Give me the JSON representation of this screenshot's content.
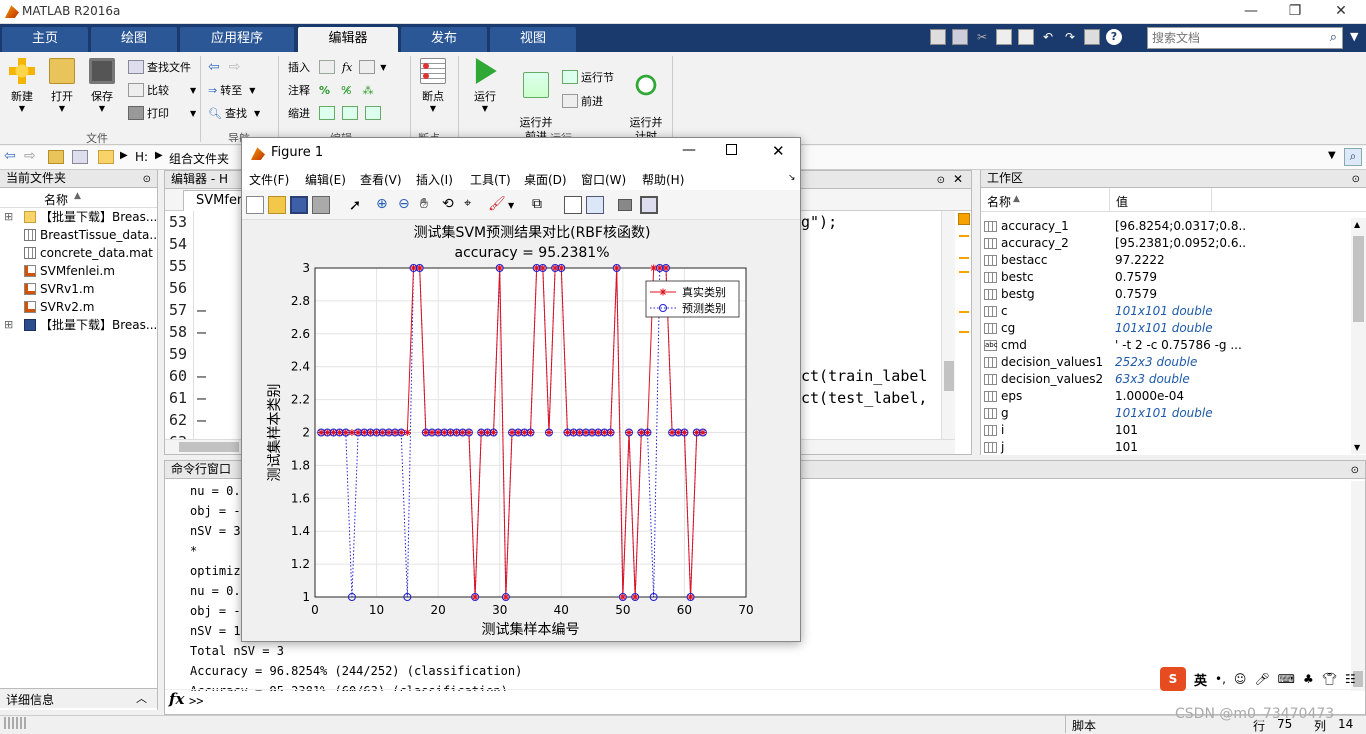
{
  "window": {
    "title": "MATLAB R2016a"
  },
  "tabs": [
    {
      "label": "主页"
    },
    {
      "label": "绘图"
    },
    {
      "label": "应用程序"
    },
    {
      "label": "编辑器"
    },
    {
      "label": "发布"
    },
    {
      "label": "视图"
    }
  ],
  "search": {
    "placeholder": "搜索文档"
  },
  "ribbon": {
    "new": "新建",
    "open": "打开",
    "save": "保存",
    "find_files": "查找文件",
    "compare": "比较",
    "print": "打印",
    "file_group": "文件",
    "goto_back": "转至",
    "find": "查找",
    "nav_group": "导航",
    "insert": "插入",
    "comment": "注释",
    "indent": "缩进",
    "edit_group": "编辑",
    "breakpoints": "断点",
    "bp_group": "断点",
    "run": "运行",
    "run_advance": "运行并\n前进",
    "run_section": "运行节",
    "advance": "前进",
    "run_time": "运行并\n计时",
    "run_group": "运行"
  },
  "address": {
    "drive": "H:",
    "folder": "组合文件夹"
  },
  "current_folder": {
    "title": "当前文件夹",
    "col_name": "名称",
    "items": [
      {
        "name": "【批量下载】Breas...",
        "icon": "folder-icon"
      },
      {
        "name": "BreastTissue_data...",
        "icon": "mat-file-icon"
      },
      {
        "name": "concrete_data.mat",
        "icon": "mat-file-icon"
      },
      {
        "name": "SVMfenlei.m",
        "icon": "m-file-icon"
      },
      {
        "name": "SVRv1.m",
        "icon": "m-file-icon"
      },
      {
        "name": "SVRv2.m",
        "icon": "m-file-icon"
      },
      {
        "name": "【批量下载】Breas...",
        "icon": "zip-icon"
      }
    ],
    "details": "详细信息"
  },
  "editor": {
    "title": "编辑器 - H",
    "tab": "SVMfen",
    "line_numbers": [
      "53",
      "54",
      "55",
      "56",
      "57",
      "58",
      "59",
      "60",
      "61",
      "62",
      "63"
    ],
    "markers": [
      "",
      "",
      "",
      "",
      "—",
      "—",
      "",
      "—",
      "—",
      "—",
      ""
    ],
    "code_right": [
      "g\");",
      "",
      "",
      "",
      "",
      "",
      "",
      "ct(train_label",
      "ct(test_label,",
      "",
      ""
    ]
  },
  "workspace": {
    "title": "工作区",
    "col_name": "名称",
    "col_value": "值",
    "vars": [
      {
        "name": "accuracy_1",
        "value": "[96.8254;0.0317;0.8...",
        "italic": false
      },
      {
        "name": "accuracy_2",
        "value": "[95.2381;0.0952;0.6...",
        "italic": false
      },
      {
        "name": "bestacc",
        "value": "97.2222",
        "italic": false
      },
      {
        "name": "bestc",
        "value": "0.7579",
        "italic": false
      },
      {
        "name": "bestg",
        "value": "0.7579",
        "italic": false
      },
      {
        "name": "c",
        "value": "101x101 double",
        "italic": true
      },
      {
        "name": "cg",
        "value": "101x101 double",
        "italic": true
      },
      {
        "name": "cmd",
        "value": "' -t 2 -c 0.75786 -g ...",
        "italic": false
      },
      {
        "name": "decision_values1",
        "value": "252x3 double",
        "italic": true
      },
      {
        "name": "decision_values2",
        "value": "63x3 double",
        "italic": true
      },
      {
        "name": "eps",
        "value": "1.0000e-04",
        "italic": false
      },
      {
        "name": "g",
        "value": "101x101 double",
        "italic": true
      },
      {
        "name": "i",
        "value": "101",
        "italic": false
      },
      {
        "name": "j",
        "value": "101",
        "italic": false
      }
    ]
  },
  "command_window": {
    "title": "命令行窗口",
    "lines": [
      "nu = 0.",
      "obj = -",
      "nSV = 39",
      "*",
      "optimiz",
      "nu = 0.",
      "obj = -",
      "nSV = 1",
      "Total nSV = 3",
      "Accuracy = 96.8254% (244/252) (classification)",
      "Accuracy = 95.2381% (60/63) (classification)"
    ],
    "prompt": ">>",
    "fx": "fx"
  },
  "status": {
    "script": "脚本",
    "row_label": "行",
    "row": "75",
    "col_label": "列",
    "col": "14"
  },
  "watermark": "CSDN @m0_73470473",
  "figure": {
    "title": "Figure 1",
    "menu": [
      "文件(F)",
      "编辑(E)",
      "查看(V)",
      "插入(I)",
      "工具(T)",
      "桌面(D)",
      "窗口(W)",
      "帮助(H)"
    ]
  },
  "chart_data": {
    "type": "line",
    "title": "测试集SVM预测结果对比(RBF核函数)",
    "subtitle": "accuracy = 95.2381%",
    "xlabel": "测试集样本编号",
    "ylabel": "测试集样本类别",
    "xlim": [
      0,
      70
    ],
    "ylim": [
      1,
      3
    ],
    "xticks": [
      0,
      10,
      20,
      30,
      40,
      50,
      60,
      70
    ],
    "yticks": [
      1,
      1.2,
      1.4,
      1.6,
      1.8,
      2,
      2.2,
      2.4,
      2.6,
      2.8,
      3
    ],
    "grid": true,
    "legend_position": "top-right",
    "series": [
      {
        "name": "真实类别",
        "color": "#e0101f",
        "marker": "star",
        "style": "solid",
        "values": [
          2,
          2,
          2,
          2,
          2,
          2,
          2,
          2,
          2,
          2,
          2,
          2,
          2,
          2,
          2,
          3,
          3,
          2,
          2,
          2,
          2,
          2,
          2,
          2,
          2,
          1,
          2,
          2,
          2,
          3,
          1,
          2,
          2,
          2,
          2,
          3,
          3,
          2,
          3,
          3,
          2,
          2,
          2,
          2,
          2,
          2,
          2,
          2,
          3,
          1,
          2,
          1,
          2,
          2,
          3,
          3,
          3,
          2,
          2,
          2,
          1,
          2,
          2
        ]
      },
      {
        "name": "预测类别",
        "color": "#1f1fd0",
        "marker": "circle",
        "style": "dotted",
        "values": [
          2,
          2,
          2,
          2,
          2,
          1,
          2,
          2,
          2,
          2,
          2,
          2,
          2,
          2,
          1,
          3,
          3,
          2,
          2,
          2,
          2,
          2,
          2,
          2,
          2,
          1,
          2,
          2,
          2,
          3,
          1,
          2,
          2,
          2,
          2,
          3,
          3,
          2,
          3,
          3,
          2,
          2,
          2,
          2,
          2,
          2,
          2,
          2,
          3,
          1,
          2,
          1,
          2,
          2,
          1,
          3,
          3,
          2,
          2,
          2,
          1,
          2,
          2
        ]
      }
    ]
  }
}
